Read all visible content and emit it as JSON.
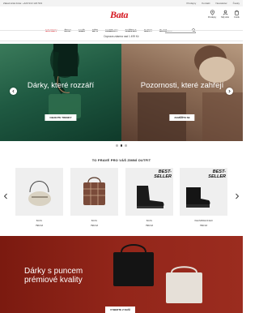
{
  "topbar": {
    "left_text": "Zákaznická linka: +420 910 120 543",
    "links": [
      "Prodejny",
      "Kontakt",
      "Newsletter",
      "Česky"
    ]
  },
  "header": {
    "logo": "Bata",
    "actions": [
      {
        "icon": "store-icon",
        "label": "Prodejny"
      },
      {
        "icon": "user-icon",
        "label": "Můj účet"
      },
      {
        "icon": "cart-icon",
        "label": "Košík"
      }
    ]
  },
  "nav": {
    "items": [
      "NOVINKY",
      "ŽENY",
      "MUŽI",
      "DĚTI",
      "KABELKY",
      "SNÍŽENO",
      "SLEVY",
      "BLOG"
    ],
    "active_index": 0,
    "search_placeholder": "Hledat"
  },
  "promo": {
    "text": "Doprava zdarma nad 1 499 Kč"
  },
  "hero": [
    {
      "title": "Dárky, které rozzáří",
      "button": "OBJEVTE TRENDY"
    },
    {
      "title": "Pozornosti, které zahřejí",
      "button": "ZAMĚŘTE SE"
    }
  ],
  "carousel": {
    "dots": 3,
    "active": 1
  },
  "products_section": {
    "title": "TO PRAVÉ PRO VÁŠ ZIMNÍ OUTFIT",
    "items": [
      {
        "brand": "BATA",
        "price": "799 Kč",
        "badge": ""
      },
      {
        "brand": "BATA",
        "price": "799 Kč",
        "badge": ""
      },
      {
        "brand": "BATA",
        "price": "799 Kč",
        "badge": "BEST-\nSELLER"
      },
      {
        "brand": "WEINBRENNER",
        "price": "799 Kč",
        "badge": "BEST-\nSELLER"
      }
    ]
  },
  "banner": {
    "title_line1": "Dárky s puncem",
    "title_line2": "prémiové kvality",
    "button": "VYBERTE Z NAŠÍ"
  },
  "colors": {
    "brand_red": "#d5161f",
    "banner_red": "#93261a",
    "hero_left_green": "#1f5a42",
    "hero_right_beige": "#8a6a54"
  }
}
